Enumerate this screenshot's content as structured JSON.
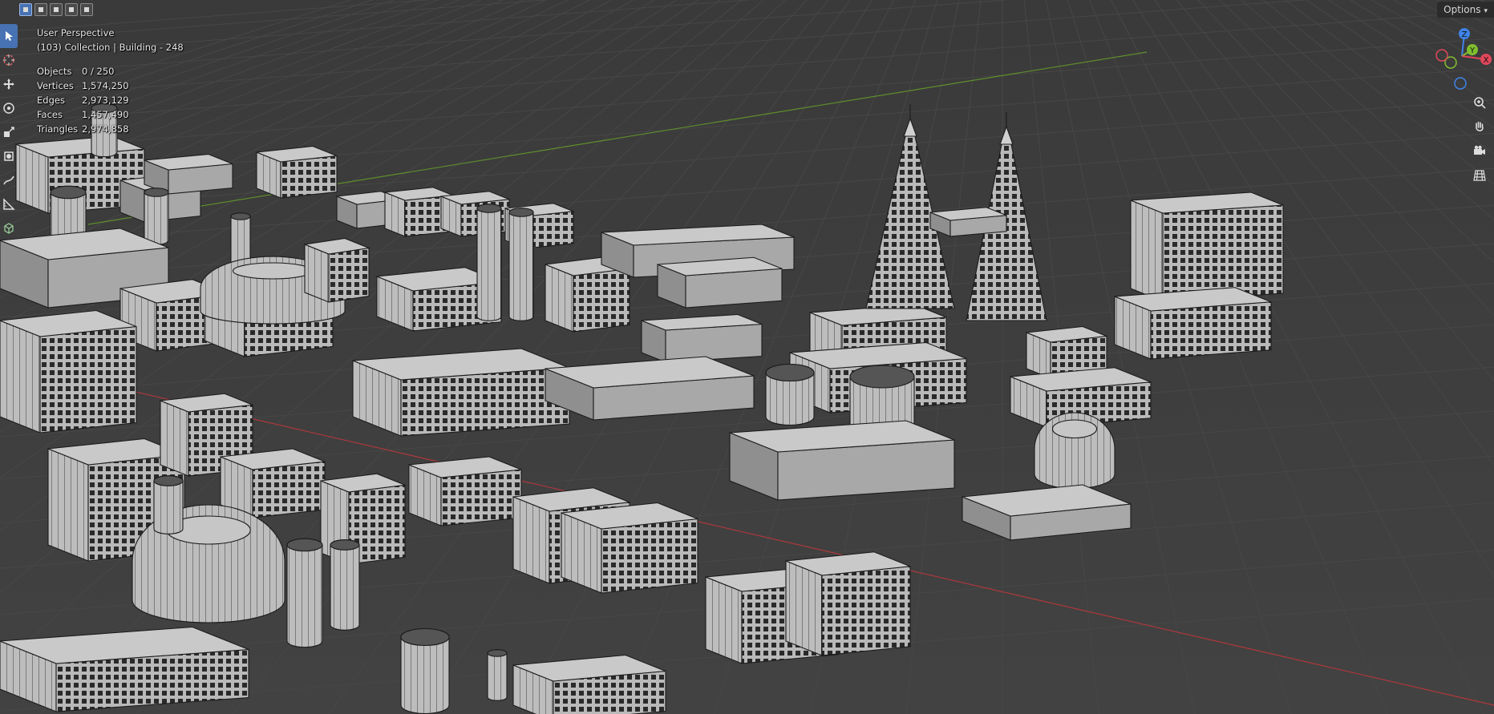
{
  "header": {
    "mode_icons": [
      "select-box-icon",
      "select-extend-icon",
      "select-subtract-icon",
      "select-invert-icon",
      "select-intersect-icon"
    ],
    "options_label": "Options"
  },
  "toolbar": {
    "tools": [
      "select-cursor-icon",
      "cursor-icon",
      "move-icon",
      "rotate-icon",
      "scale-icon",
      "transform-icon",
      "annotate-icon",
      "measure-icon",
      "add-cube-icon"
    ]
  },
  "overlay": {
    "view_name": "User Perspective",
    "collection": "(103) Collection | Building - 248",
    "stats": [
      {
        "label": "Objects",
        "value": "0 / 250"
      },
      {
        "label": "Vertices",
        "value": "1,574,250"
      },
      {
        "label": "Edges",
        "value": "2,973,129"
      },
      {
        "label": "Faces",
        "value": "1,457,490"
      },
      {
        "label": "Triangles",
        "value": "2,974,858"
      }
    ]
  },
  "gizmo": {
    "z": "Z",
    "y": "Y",
    "x": "X",
    "colors": {
      "x": "#e0475b",
      "y": "#7fbf2f",
      "z": "#3f83e6"
    }
  },
  "navigation": [
    "zoom-icon",
    "pan-hand-icon",
    "camera-icon",
    "grid-ortho-icon"
  ],
  "colors": {
    "background": "#3d3d3d",
    "grid": "#4a4a4a",
    "accent": "#4772b3"
  }
}
